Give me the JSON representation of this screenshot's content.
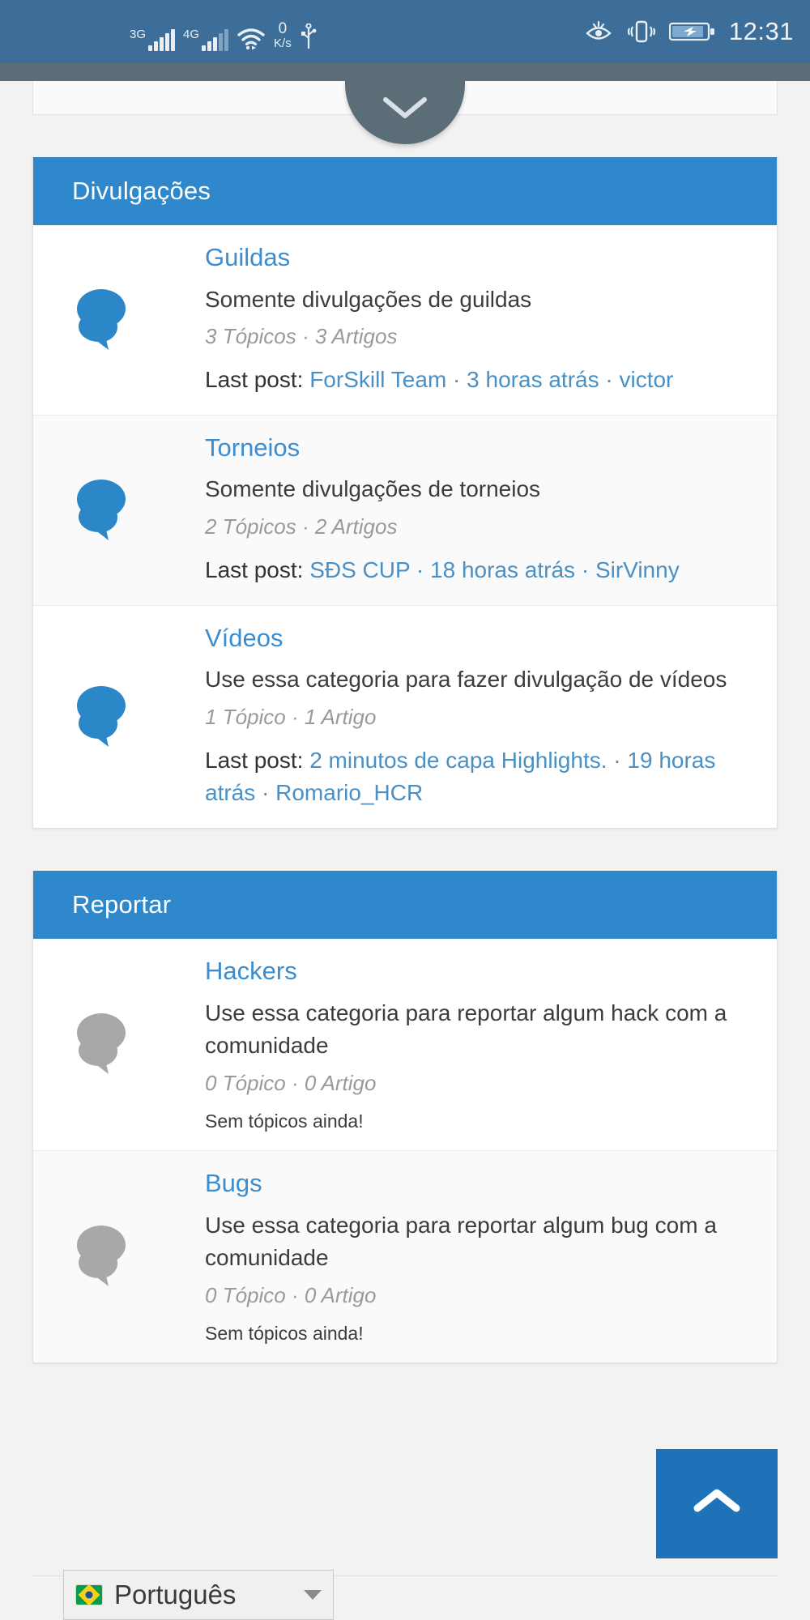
{
  "status_bar": {
    "network_3g": "3G",
    "network_4g": "4G",
    "data_rate_value": "0",
    "data_rate_unit": "K/s",
    "time": "12:31",
    "icons": [
      "signal-3g-icon",
      "signal-4g-icon",
      "wifi-icon",
      "data-rate-indicator",
      "usb-icon",
      "eye-care-icon",
      "vibrate-icon",
      "battery-charging-icon"
    ]
  },
  "collapse_button": {
    "icon": "chevron-down-icon"
  },
  "sections": [
    {
      "title": "Divulgações",
      "icon_color": "#2b87c8",
      "rows": [
        {
          "name": "Guildas",
          "description": "Somente divulgações de guildas",
          "stats": "3 Tópicos · 3 Artigos",
          "last_post_label": "Last post:",
          "last_post_title": "ForSkill Team",
          "last_post_time": "3 horas atrás",
          "last_post_user": "victor",
          "empty": ""
        },
        {
          "name": "Torneios",
          "description": "Somente divulgações de torneios",
          "stats": "2 Tópicos · 2 Artigos",
          "last_post_label": "Last post:",
          "last_post_title": "SÐS CUP",
          "last_post_time": "18 horas atrás",
          "last_post_user": "SirVinny",
          "empty": ""
        },
        {
          "name": "Vídeos",
          "description": "Use essa categoria para fazer divulgação de vídeos",
          "stats": "1 Tópico ·  1 Artigo",
          "last_post_label": "Last post:",
          "last_post_title": "2 minutos de capa Highlights.",
          "last_post_time": "19 horas atrás",
          "last_post_user": "Romario_HCR",
          "empty": ""
        }
      ]
    },
    {
      "title": "Reportar",
      "icon_color": "#a8a8a8",
      "rows": [
        {
          "name": "Hackers",
          "description": "Use essa categoria para reportar algum hack com a comunidade",
          "stats": "0 Tópico ·  0 Artigo",
          "last_post_label": "",
          "last_post_title": "",
          "last_post_time": "",
          "last_post_user": "",
          "empty": "Sem tópicos ainda!"
        },
        {
          "name": "Bugs",
          "description": "Use essa categoria para reportar algum bug com a comunidade",
          "stats": "0 Tópico ·  0 Artigo",
          "last_post_label": "",
          "last_post_title": "",
          "last_post_time": "",
          "last_post_user": "",
          "empty": "Sem tópicos ainda!"
        }
      ]
    }
  ],
  "scroll_top_button": {
    "icon": "chevron-up-icon"
  },
  "language_selector": {
    "value": "Português",
    "flag": "brazil-flag-icon",
    "caret": "caret-down-icon"
  },
  "colors": {
    "accent": "#2f88cc",
    "link": "#3b8dd0",
    "statusbar": "#3d6e99",
    "scroll_top": "#1d72b8",
    "muted_icon": "#a8a8a8"
  }
}
